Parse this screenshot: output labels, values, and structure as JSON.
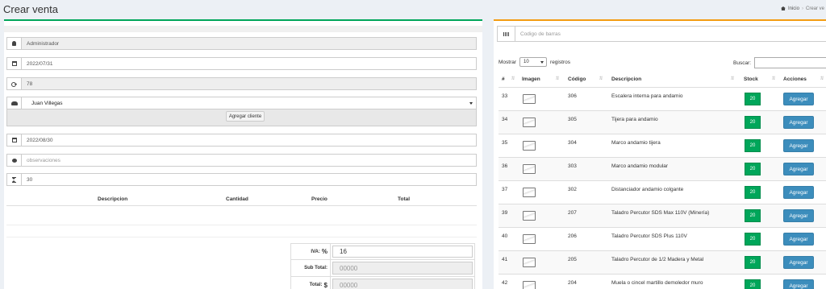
{
  "header": {
    "title": "Crear venta",
    "breadcrumb": {
      "home": "Inicio",
      "current": "Crear ve"
    }
  },
  "form": {
    "vendedor": "Administrador",
    "fecha_venta": "2022/07/31",
    "codigo": "78",
    "cliente": "Juan Villegas",
    "agregar_cliente_label": "Agregar cliente",
    "fecha_entrega": "2022/08/30",
    "observaciones_placeholder": "observaciones",
    "dias": "30"
  },
  "detalle": {
    "headers": [
      "Descripcion",
      "Cantidad",
      "Precio",
      "Total"
    ]
  },
  "totales": {
    "iva_label": "IVA:",
    "iva_symbol": "%",
    "iva_value": "16",
    "subtotal_label": "Sub Total:",
    "subtotal_value": "00000",
    "total_label": "Total:",
    "total_symbol": "$",
    "total_value": "00000"
  },
  "productos": {
    "barcode_placeholder": "Codigo de barras",
    "mostrar_label": "Mostrar",
    "entries_value": "10",
    "registros_label": "registros",
    "buscar_label": "Buscar:",
    "headers": [
      "#",
      "Imagen",
      "Código",
      "Descripcion",
      "Stock",
      "Acciones"
    ],
    "add_label": "Agregar",
    "rows": [
      {
        "num": "33",
        "codigo": "306",
        "descripcion": "Escalera interna para andamio",
        "stock": "20"
      },
      {
        "num": "34",
        "codigo": "305",
        "descripcion": "Tijera para andamio",
        "stock": "20"
      },
      {
        "num": "35",
        "codigo": "304",
        "descripcion": "Marco andamio tijera",
        "stock": "20"
      },
      {
        "num": "36",
        "codigo": "303",
        "descripcion": "Marco andamio modular",
        "stock": "20"
      },
      {
        "num": "37",
        "codigo": "302",
        "descripcion": "Distanciador andamio colgante",
        "stock": "20"
      },
      {
        "num": "39",
        "codigo": "207",
        "descripcion": "Taladro Percutor SDS Max 110V (Minería)",
        "stock": "20"
      },
      {
        "num": "40",
        "codigo": "206",
        "descripcion": "Taladro Percutor SDS Plus 110V",
        "stock": "20"
      },
      {
        "num": "41",
        "codigo": "205",
        "descripcion": "Taladro Percutor de 1/2 Madera y Metal",
        "stock": "20"
      },
      {
        "num": "42",
        "codigo": "204",
        "descripcion": "Muela o cincel martillo demoledor muro",
        "stock": "20"
      }
    ]
  }
}
